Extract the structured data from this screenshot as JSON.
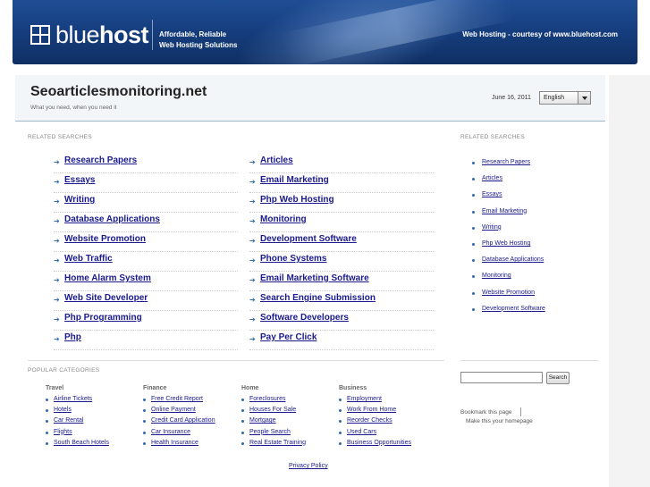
{
  "banner": {
    "logo_text_light": "blue",
    "logo_text_bold": "host",
    "tagline_line1": "Affordable, Reliable",
    "tagline_line2": "Web Hosting Solutions",
    "courtesy": "Web Hosting - courtesy of www.bluehost.com",
    "colors": {
      "banner_bg": "#163f80",
      "link": "#1a1a8c",
      "bullet": "#2f6aa8"
    }
  },
  "header": {
    "title": "Seoarticlesmonitoring.net",
    "subtitle": "What you need, when you need it",
    "date": "June 16, 2011",
    "language": "English"
  },
  "related": {
    "label": "RELATED SEARCHES",
    "left": [
      "Research Papers",
      "Essays",
      "Writing",
      "Database Applications",
      "Website Promotion",
      "Web Traffic",
      "Home Alarm System",
      "Web Site Developer",
      "Php Programming",
      "Php"
    ],
    "right": [
      "Articles",
      "Email Marketing",
      "Php Web Hosting",
      "Monitoring",
      "Development Software",
      "Phone Systems",
      "Email Marketing Software",
      "Search Engine Submission",
      "Software Developers",
      "Pay Per Click"
    ]
  },
  "sidebar": {
    "label": "RELATED SEARCHES",
    "items": [
      "Research Papers",
      "Articles",
      "Essays",
      "Email Marketing",
      "Writing",
      "Php Web Hosting",
      "Database Applications",
      "Monitoring",
      "Website Promotion",
      "Development Software"
    ],
    "search_button": "Search",
    "bookmark": "Bookmark this page",
    "homepage": "Make this your homepage"
  },
  "popular": {
    "label": "POPULAR CATEGORIES",
    "columns": [
      {
        "title": "Travel",
        "items": [
          "Airline Tickets",
          "Hotels",
          "Car Rental",
          "Flights",
          "South Beach Hotels"
        ]
      },
      {
        "title": "Finance",
        "items": [
          "Free Credit Report",
          "Online Payment",
          "Credit Card Application",
          "Car Insurance",
          "Health Insurance"
        ]
      },
      {
        "title": "Home",
        "items": [
          "Foreclosures",
          "Houses For Sale",
          "Mortgage",
          "People Search",
          "Real Estate Training"
        ]
      },
      {
        "title": "Business",
        "items": [
          "Employment",
          "Work From Home",
          "Reorder Checks",
          "Used Cars",
          "Business Opportunities"
        ]
      }
    ]
  },
  "footer": {
    "privacy": "Privacy Policy"
  }
}
